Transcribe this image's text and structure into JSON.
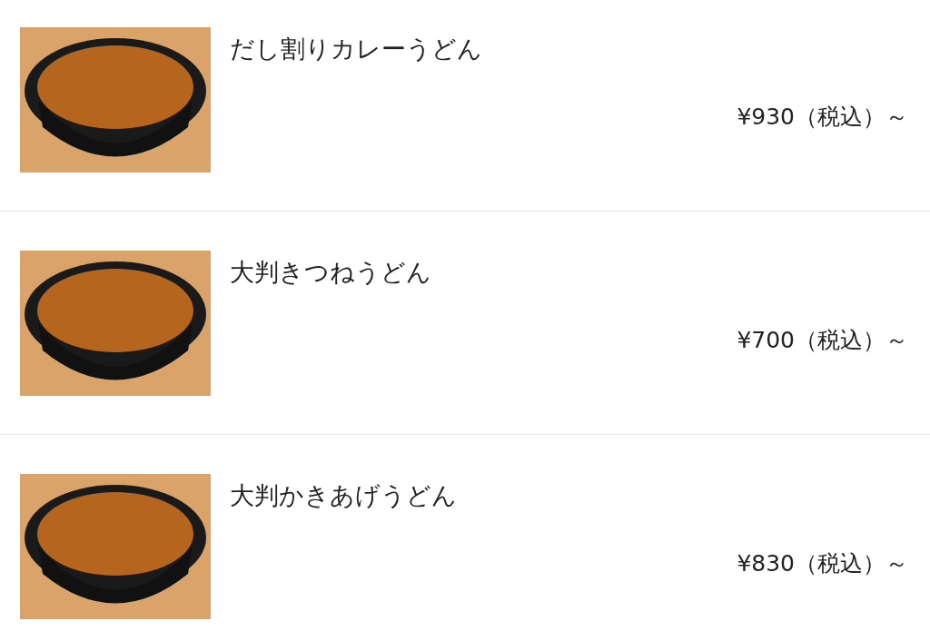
{
  "menu_items": [
    {
      "name": "だし割りカレーうどん",
      "price": "¥930（税込）～"
    },
    {
      "name": "大判きつねうどん",
      "price": "¥700（税込）～"
    },
    {
      "name": "大判かきあげうどん",
      "price": "¥830（税込）～"
    }
  ]
}
